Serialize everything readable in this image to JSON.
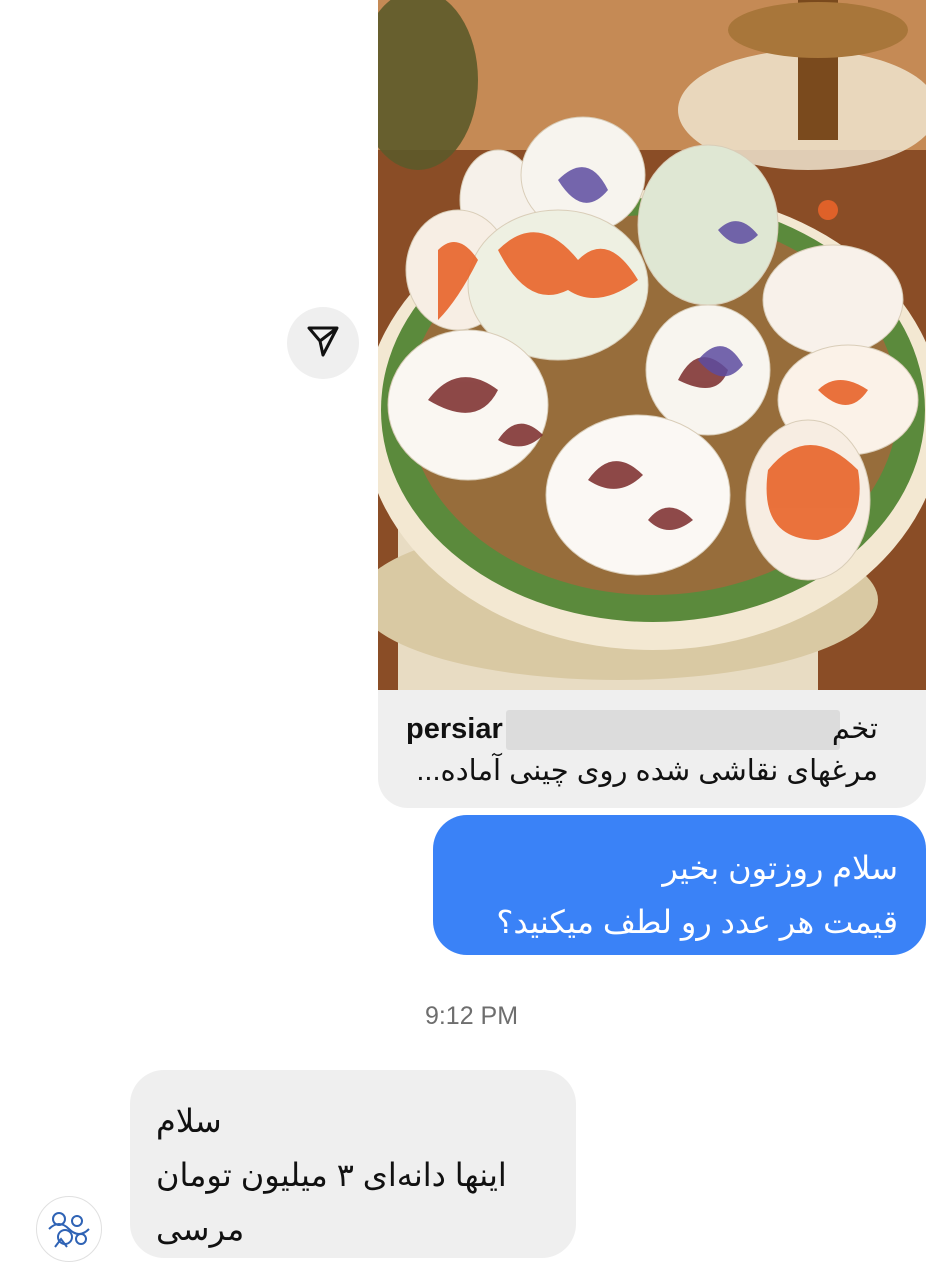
{
  "shared_post": {
    "username": "persiar",
    "caption_line1": "تخم",
    "caption_line2": "مرغهای نقاشی شده روی چینی آماده...",
    "image_subject": "painted-eggs-on-porcelain-bowl",
    "share_icon": "send-icon"
  },
  "messages": {
    "outgoing": {
      "line1": "سلام روزتون بخیر",
      "line2": "قیمت هر عدد رو لطف میکنید؟"
    },
    "timestamp": "9:12 PM",
    "incoming": {
      "line1": "سلام",
      "line2": "اینها دانه‌ای ۳ میلیون تومان",
      "line3": "مرسی"
    }
  },
  "colors": {
    "outgoing_bubble": "#3a82f7",
    "incoming_bubble": "#efefef",
    "timestamp_text": "#6e6e6e"
  }
}
